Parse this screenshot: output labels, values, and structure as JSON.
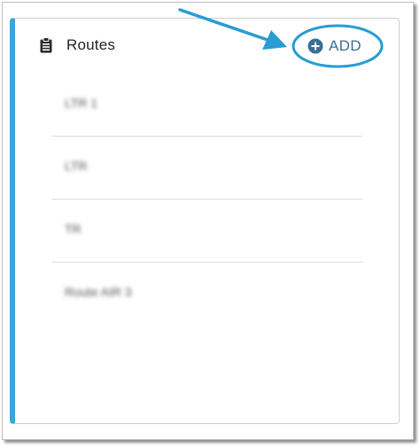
{
  "card": {
    "title": "Routes",
    "title_icon": "clipboard-list-icon",
    "accent_color": "#3fa3dc",
    "add_button": {
      "label": "ADD",
      "icon": "plus-circle-icon",
      "color": "#3a6f96"
    }
  },
  "routes": [
    {
      "label": "LTR 1"
    },
    {
      "label": "LTR"
    },
    {
      "label": "TR"
    },
    {
      "label": "Route AIR 3"
    }
  ],
  "annotation": {
    "arrow_color": "#2a9bd4",
    "highlight_color": "#2a9bd4"
  }
}
